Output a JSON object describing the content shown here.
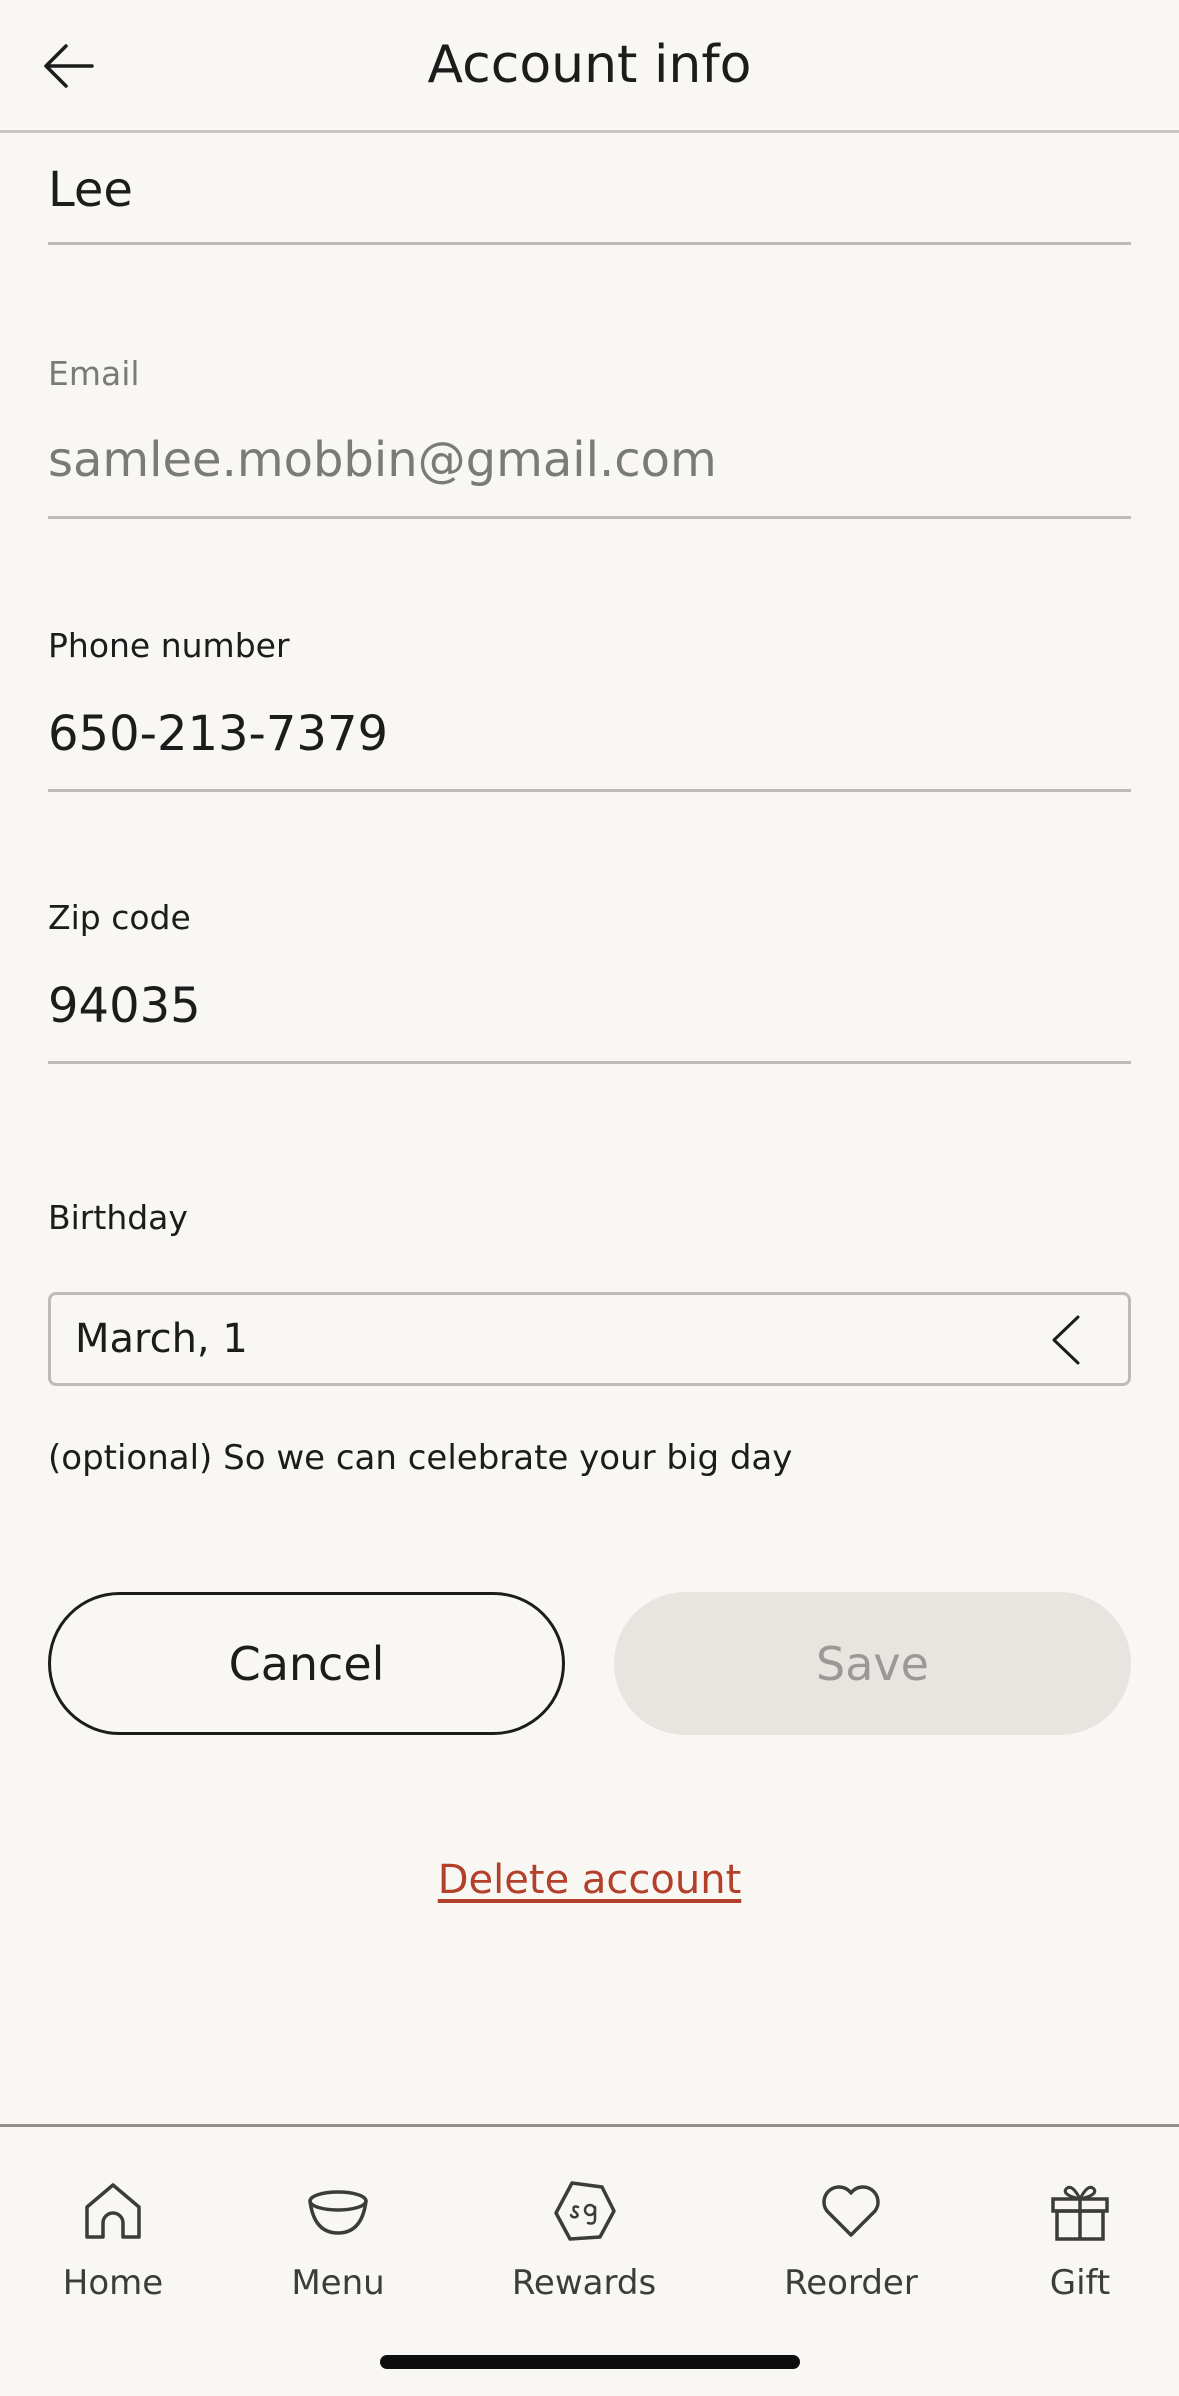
{
  "header": {
    "title": "Account info"
  },
  "form": {
    "last_name_value": "Lee",
    "email_label": "Email",
    "email_value": "samlee.mobbin@gmail.com",
    "phone_label": "Phone number",
    "phone_value": "650-213-7379",
    "zip_label": "Zip code",
    "zip_value": "94035",
    "birthday_label": "Birthday",
    "birthday_value": "March, 1",
    "birthday_helper": "(optional) So we can celebrate your big day"
  },
  "actions": {
    "cancel_label": "Cancel",
    "save_label": "Save",
    "delete_label": "Delete account"
  },
  "tabbar": {
    "items": [
      {
        "label": "Home",
        "icon": "home-icon"
      },
      {
        "label": "Menu",
        "icon": "bowl-icon"
      },
      {
        "label": "Rewards",
        "icon": "rewards-badge-icon"
      },
      {
        "label": "Reorder",
        "icon": "heart-icon"
      },
      {
        "label": "Gift",
        "icon": "gift-icon"
      }
    ]
  },
  "colors": {
    "background": "#f8f7f3",
    "text": "#1c1c1c",
    "muted_text": "#7a7a77",
    "delete": "#b3402a",
    "save_disabled_bg": "#e6e5e0"
  }
}
